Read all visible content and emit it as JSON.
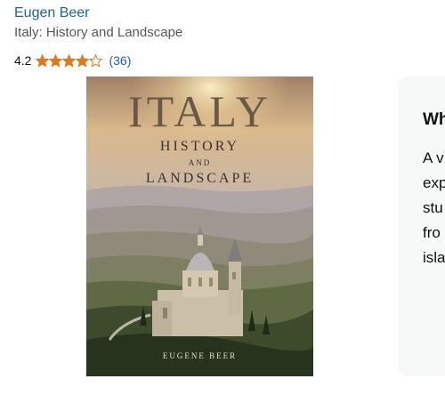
{
  "product": {
    "author": "Eugen Beer",
    "title": "Italy: History and Landscape",
    "rating": "4.2",
    "rating_fraction": 0.84,
    "star_count": 5,
    "review_count": "(36)",
    "star_color": "#de7921"
  },
  "cover": {
    "title": "ITALY",
    "subtitle_line1": "HISTORY",
    "subtitle_and": "AND",
    "subtitle_line2": "LANDSCAPE",
    "author": "EUGENE BEER"
  },
  "side_panel": {
    "heading": "Wh",
    "lines": [
      "A v",
      "exp",
      "stu",
      "fro",
      "isla"
    ]
  }
}
